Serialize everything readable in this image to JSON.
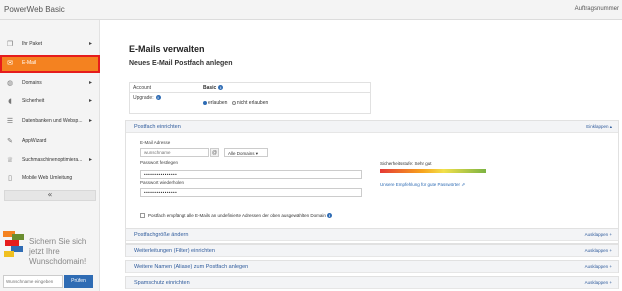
{
  "header": {
    "brand": "PowerWeb Basic",
    "order_label": "Auftragsnummer"
  },
  "sidebar": {
    "items": [
      {
        "label": "Ihr Paket",
        "icon": "package-icon",
        "has_arrow": true
      },
      {
        "label": "E-Mail",
        "icon": "mail-icon",
        "active": true,
        "has_arrow": false
      },
      {
        "label": "Domains",
        "icon": "globe-icon",
        "has_arrow": true
      },
      {
        "label": "Sicherheit",
        "icon": "shield-icon",
        "has_arrow": true
      },
      {
        "label": "Datenbanken und Websp...",
        "icon": "database-icon",
        "has_arrow": true
      },
      {
        "label": "AppWizard",
        "icon": "wand-icon",
        "has_arrow": false
      },
      {
        "label": "Suchmaschinenoptimiera...",
        "icon": "trophy-icon",
        "has_arrow": true
      },
      {
        "label": "Mobile Web Umleitung",
        "icon": "mobile-icon",
        "has_arrow": false
      }
    ],
    "collapse_glyph": "«",
    "active_color": "#f48220"
  },
  "promo": {
    "text": "Sichern Sie sich jetzt Ihre Wunschdomain!",
    "input_placeholder": "Wunschname eingeben",
    "button": "Prüfen"
  },
  "main": {
    "title": "E-Mails verwalten",
    "subtitle": "Neues E-Mail Postfach anlegen",
    "account_table": {
      "row1": {
        "label": "Account",
        "value": "Basic"
      },
      "row2": {
        "label": "Upgrade",
        "option_on": "erlauben",
        "option_off": "nicht erlauben"
      }
    },
    "postfach_panel": {
      "title": "Postfach einrichten",
      "toggle": "Einklappen",
      "email_label": "E-Mail Adresse",
      "email_placeholder": "wunschname",
      "at_symbol": "@",
      "domain_select": "Alle Domains",
      "password_label": "Passwort festlegen",
      "password_value": "••••••••••••••••",
      "password_repeat_label": "Passwort wiederholen",
      "password_repeat_value": "••••••••••••••••",
      "strength_label": "Sicherheitsstufe: Sehr gut",
      "recommendation_link": "Unsere Empfehlung für gute Passwörter",
      "catchall_label": "Postfach empfängt alle E-Mails an undefinierte Adressen der oben ausgewählten Domain"
    },
    "collapsed_panels": [
      {
        "title": "Postfachgröße ändern",
        "toggle": "Ausklappen"
      },
      {
        "title": "Weiterleitungen (Filter) einrichten",
        "toggle": "Ausklappen"
      },
      {
        "title": "Weitere Namen (Aliase) zum Postfach anlegen",
        "toggle": "Ausklappen"
      },
      {
        "title": "Spamschutz einrichten",
        "toggle": "Ausklappen"
      }
    ]
  }
}
